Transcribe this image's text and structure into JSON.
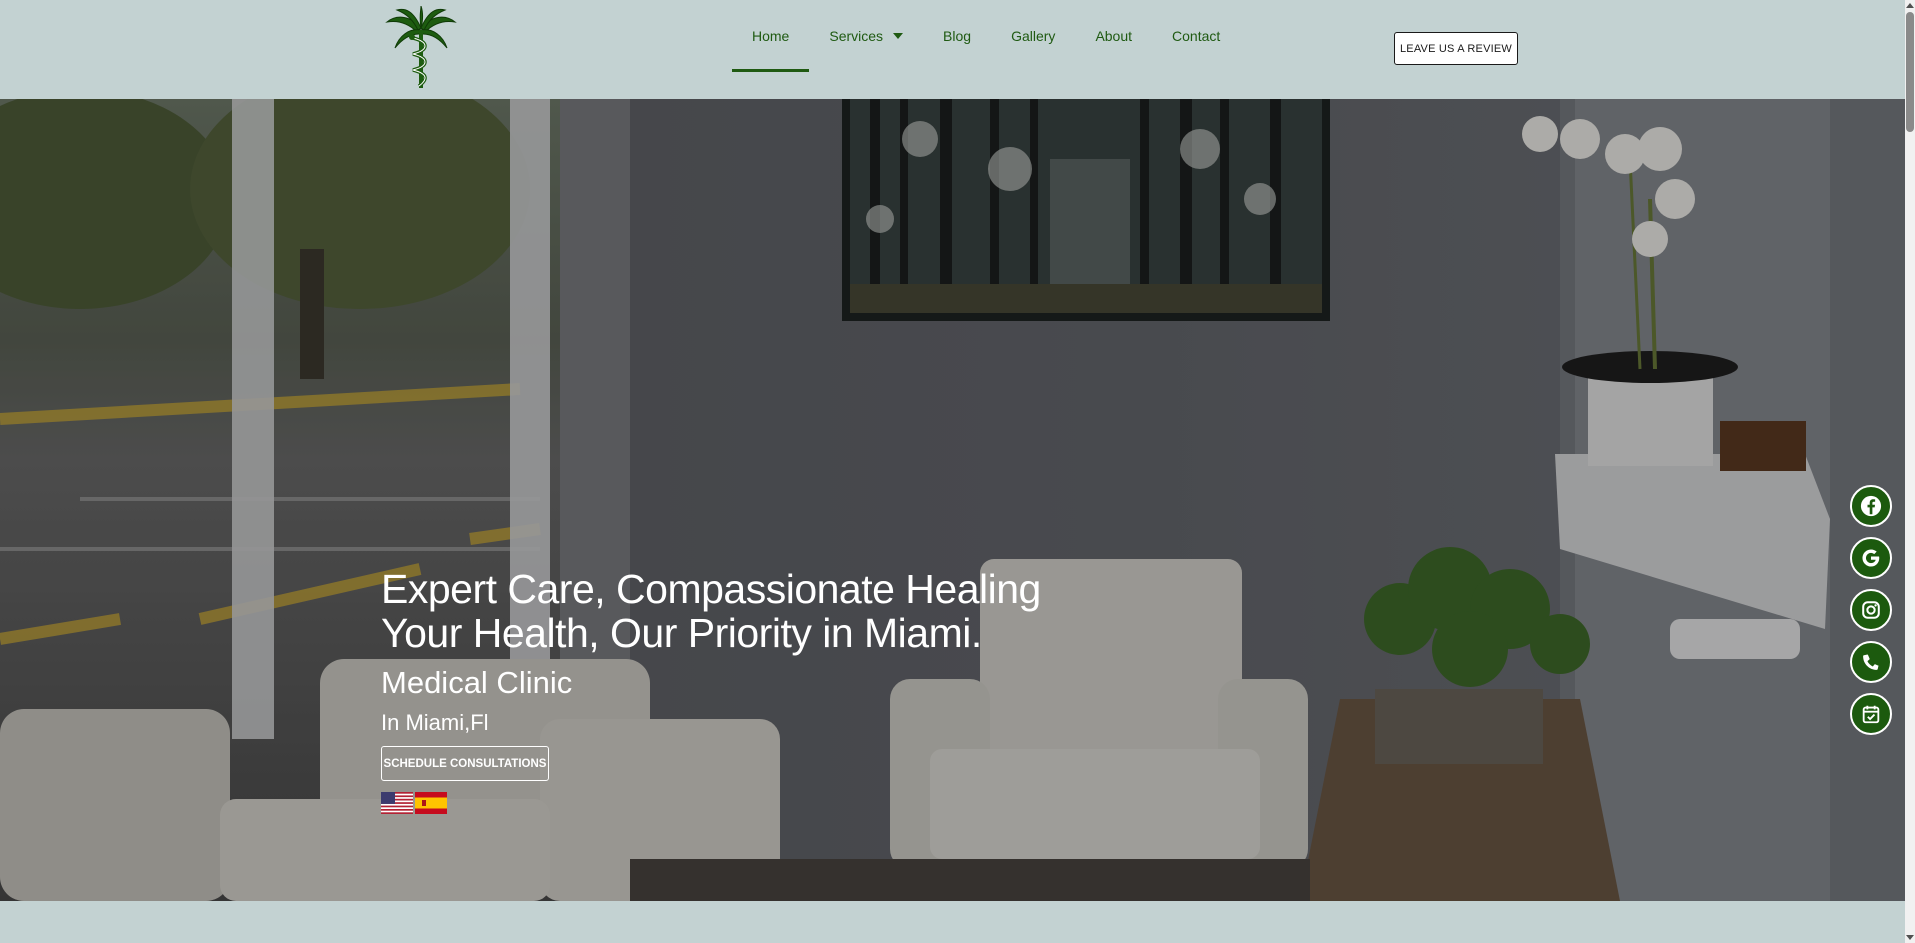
{
  "header": {
    "logo_icon": "palm-caduceus-logo-icon",
    "nav": [
      {
        "label": "Home",
        "active": true
      },
      {
        "label": "Services",
        "dropdown": true
      },
      {
        "label": "Blog"
      },
      {
        "label": "Gallery"
      },
      {
        "label": "About"
      },
      {
        "label": "Contact"
      }
    ],
    "review_button": "LEAVE US A REVIEW"
  },
  "hero": {
    "headline_line1": "Expert Care, Compassionate Healing",
    "headline_line2": "Your Health, Our Priority in Miami.",
    "subtitle": "Medical Clinic",
    "location": "In Miami,Fl",
    "cta_button": "SCHEDULE CONSULTATIONS",
    "languages": [
      {
        "icon": "us-flag-icon",
        "lang": "English"
      },
      {
        "icon": "spain-flag-icon",
        "lang": "Spanish"
      }
    ]
  },
  "social": [
    {
      "icon": "facebook-icon"
    },
    {
      "icon": "google-icon"
    },
    {
      "icon": "instagram-icon"
    },
    {
      "icon": "phone-icon"
    },
    {
      "icon": "calendar-check-icon"
    }
  ],
  "colors": {
    "brand_green": "#1f5a12",
    "header_bg": "#c3d2d2",
    "button_border": "#1a1a1a"
  }
}
